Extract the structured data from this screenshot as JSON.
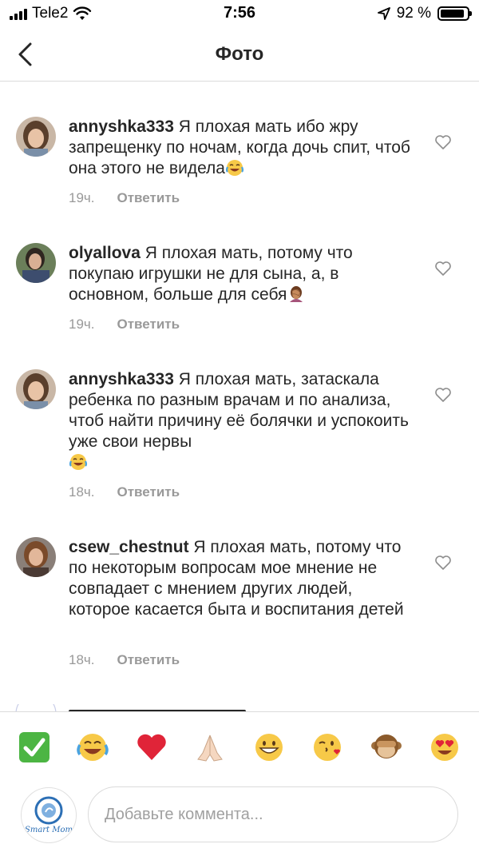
{
  "status_bar": {
    "carrier": "Tele2",
    "time": "7:56",
    "battery": "92 %",
    "battery_level": 0.92
  },
  "header": {
    "title": "Фото"
  },
  "comments": [
    {
      "username": "annyshka333",
      "text": " Я плохая мать ибо жру запрещенку по ночам, когда дочь спит, чтоб она этого не видела",
      "emoji": "face-with-tears-of-joy",
      "time": "19ч.",
      "reply": "Ответить"
    },
    {
      "username": "olyallova",
      "text": " Я плохая мать, потому что покупаю игрушки не для сына, а, в основном, больше для себя",
      "emoji": "woman-facepalming",
      "time": "19ч.",
      "reply": "Ответить"
    },
    {
      "username": "annyshka333",
      "text": " Я плохая мать, затаскала ребенка по разным врачам и по анализа, чтоб найти причину её болячки и успокоить уже свои нервы",
      "emoji": "face-with-tears-of-joy",
      "time": "18ч.",
      "reply": "Ответить"
    },
    {
      "username": "csew_chestnut",
      "text": " Я плохая мать, потому что по некоторым вопросам мое мнение не совпадает с мнением других людей, которое касается быта и воспитания детей",
      "emoji": "",
      "time": "18ч.",
      "reply": "Ответить"
    }
  ],
  "emoji_bar": [
    "check-mark-button",
    "face-with-tears-of-joy",
    "red-heart",
    "folded-hands",
    "grinning-face",
    "face-blowing-kiss",
    "see-no-evil-monkey",
    "heart-eyes-face"
  ],
  "comment_input": {
    "placeholder": "Добавьте коммента...",
    "value": ""
  },
  "my_avatar": {
    "brand": "Smart Mom"
  },
  "colors": {
    "text": "#262626",
    "meta": "#999999",
    "divider": "#dbdbdb"
  }
}
